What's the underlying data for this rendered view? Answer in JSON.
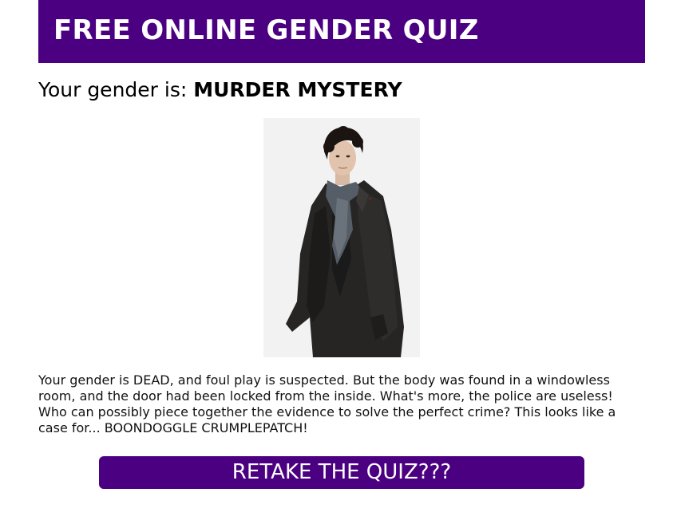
{
  "header": {
    "title": "FREE ONLINE GENDER QUIZ",
    "background_color": "#4b0082"
  },
  "result": {
    "prefix": "Your gender is:",
    "value": "MURDER MYSTERY",
    "image_icon": "portrait-photo"
  },
  "description": "Your gender is DEAD, and foul play is suspected. But the body was found in a windowless room, and the door had been locked from the inside. What's more, the police are useless! Who can possibly piece together the evidence to solve the perfect crime? This looks like a case for... BOONDOGGLE CRUMPLEPATCH!",
  "actions": {
    "retake_label": "RETAKE THE QUIZ???",
    "button_color": "#4b0082"
  }
}
